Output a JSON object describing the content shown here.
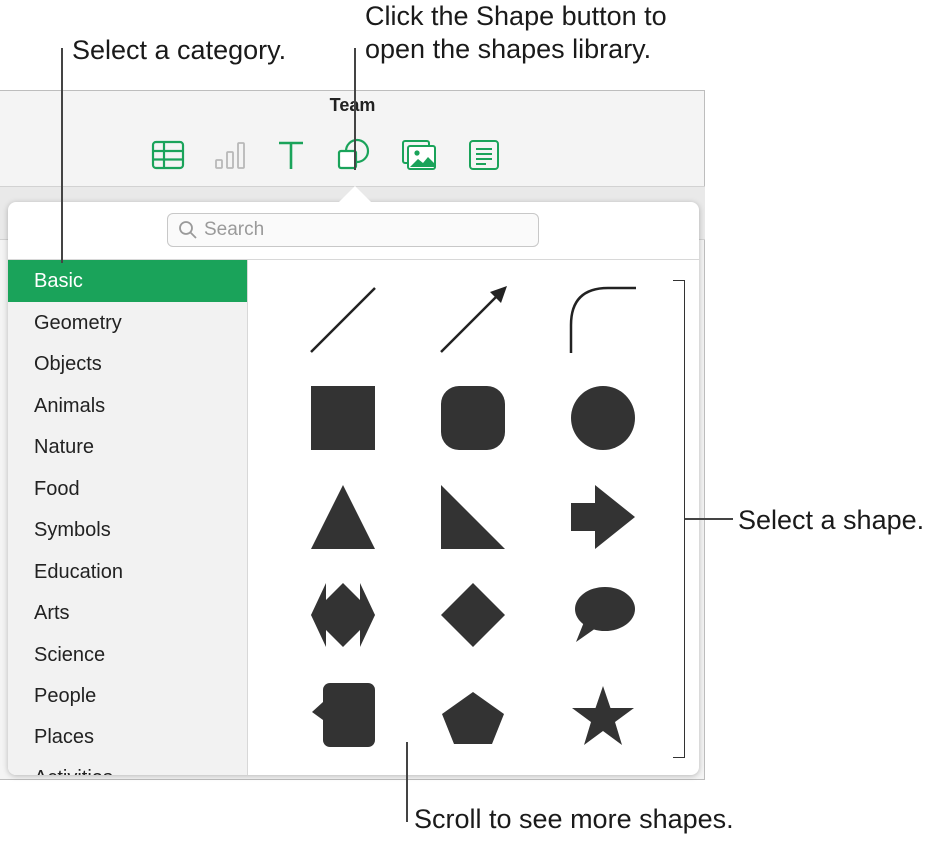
{
  "callouts": {
    "category": "Select a category.",
    "shape_button_line1": "Click the Shape button to",
    "shape_button_line2": "open the shapes library.",
    "select_shape": "Select a shape.",
    "scroll": "Scroll to see more shapes."
  },
  "window": {
    "title": "Team"
  },
  "toolbar": {
    "buttons": [
      {
        "name": "table-icon",
        "active": true
      },
      {
        "name": "chart-icon",
        "active": false
      },
      {
        "name": "text-icon",
        "active": true
      },
      {
        "name": "shape-icon",
        "active": true
      },
      {
        "name": "media-icon",
        "active": true
      },
      {
        "name": "comment-icon",
        "active": true
      }
    ]
  },
  "search": {
    "placeholder": "Search",
    "value": ""
  },
  "categories": [
    "Basic",
    "Geometry",
    "Objects",
    "Animals",
    "Nature",
    "Food",
    "Symbols",
    "Education",
    "Arts",
    "Science",
    "People",
    "Places",
    "Activities"
  ],
  "selected_category": "Basic",
  "shapes": [
    "line",
    "arrow-line",
    "curve",
    "square",
    "rounded-square",
    "circle",
    "triangle",
    "right-triangle",
    "arrow",
    "double-arrow",
    "diamond",
    "speech-bubble",
    "callout-square",
    "pentagon",
    "star"
  ],
  "colors": {
    "accent": "#1aa35a",
    "shape_fill": "#333333"
  }
}
